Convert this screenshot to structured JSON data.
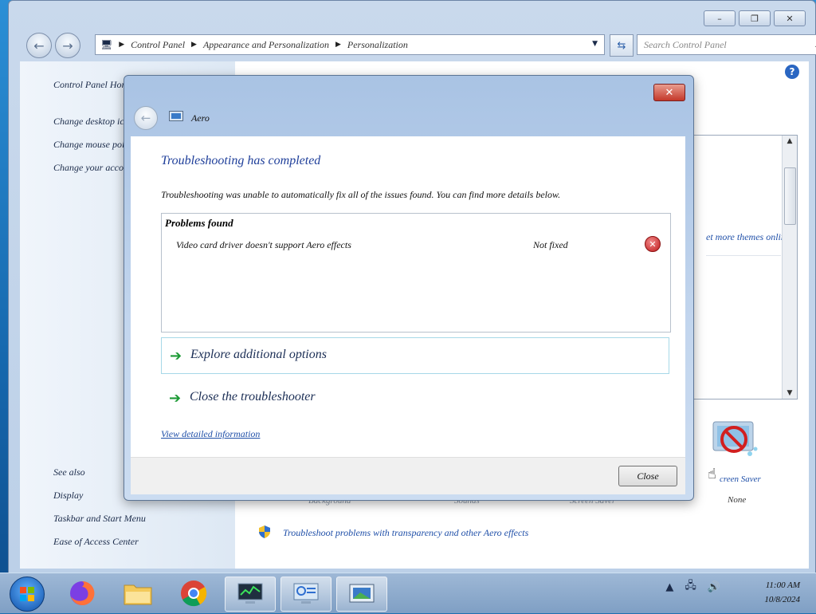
{
  "window": {
    "minimize": "–",
    "maximize": "❐",
    "close": "✕"
  },
  "nav": {
    "breadcrumb": [
      "Control Panel",
      "Appearance and Personalization",
      "Personalization"
    ],
    "search_placeholder": "Search Control Panel"
  },
  "sidebar": {
    "home": "Control Panel Home",
    "items": [
      "Change desktop icons",
      "Change mouse pointers",
      "Change your account pi"
    ],
    "see_also_title": "See also",
    "see_also": [
      "Display",
      "Taskbar and Start Menu",
      "Ease of Access Center"
    ]
  },
  "main": {
    "more_themes": "et more themes online",
    "screensaver_label": "creen Saver",
    "screensaver_value": "None",
    "bottom_labels": [
      "Background",
      "Sounds",
      "Screen Saver"
    ],
    "troubleshoot_link": "Troubleshoot problems with transparency and other Aero effects"
  },
  "dialog": {
    "title": "Aero",
    "heading": "Troubleshooting has completed",
    "description": "Troubleshooting was unable to automatically fix all of the issues found. You can find more details below.",
    "problems_header": "Problems found",
    "problem_name": "Video card driver doesn't support Aero effects",
    "problem_status": "Not fixed",
    "option1": "Explore additional options",
    "option2": "Close the troubleshooter",
    "detail_link": "View detailed information",
    "close_button": "Close"
  },
  "taskbar": {
    "clock_time": "11:00 AM",
    "clock_date": "10/8/2024"
  }
}
